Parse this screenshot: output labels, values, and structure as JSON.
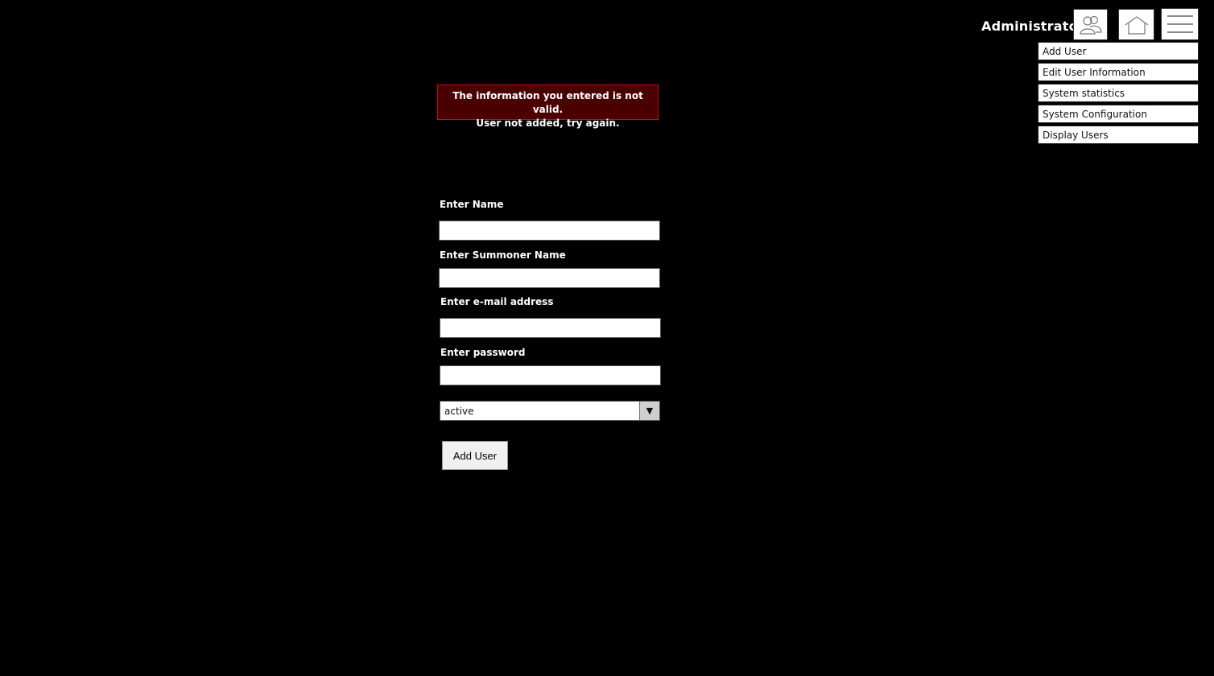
{
  "header": {
    "user_label": "Administrator",
    "icons": {
      "users": "users-icon",
      "home": "home-icon",
      "menu": "hamburger-menu-icon"
    }
  },
  "menu": {
    "items": [
      {
        "label": "Add User"
      },
      {
        "label": "Edit User Information"
      },
      {
        "label": "System statistics"
      },
      {
        "label": "System Configuration"
      },
      {
        "label": "Display Users"
      }
    ]
  },
  "alert": {
    "line1": "The information you entered is not valid.",
    "line2": "User not added, try again.",
    "background": "#4a0000",
    "border": "#c01010"
  },
  "form": {
    "name_label": "Enter Name",
    "name_value": "",
    "summoner_label": "Enter Summoner Name",
    "summoner_value": "",
    "email_label": "Enter e-mail address",
    "email_value": "",
    "password_label": "Enter password",
    "password_value": "",
    "status_selected": "active",
    "submit_label": "Add User"
  }
}
